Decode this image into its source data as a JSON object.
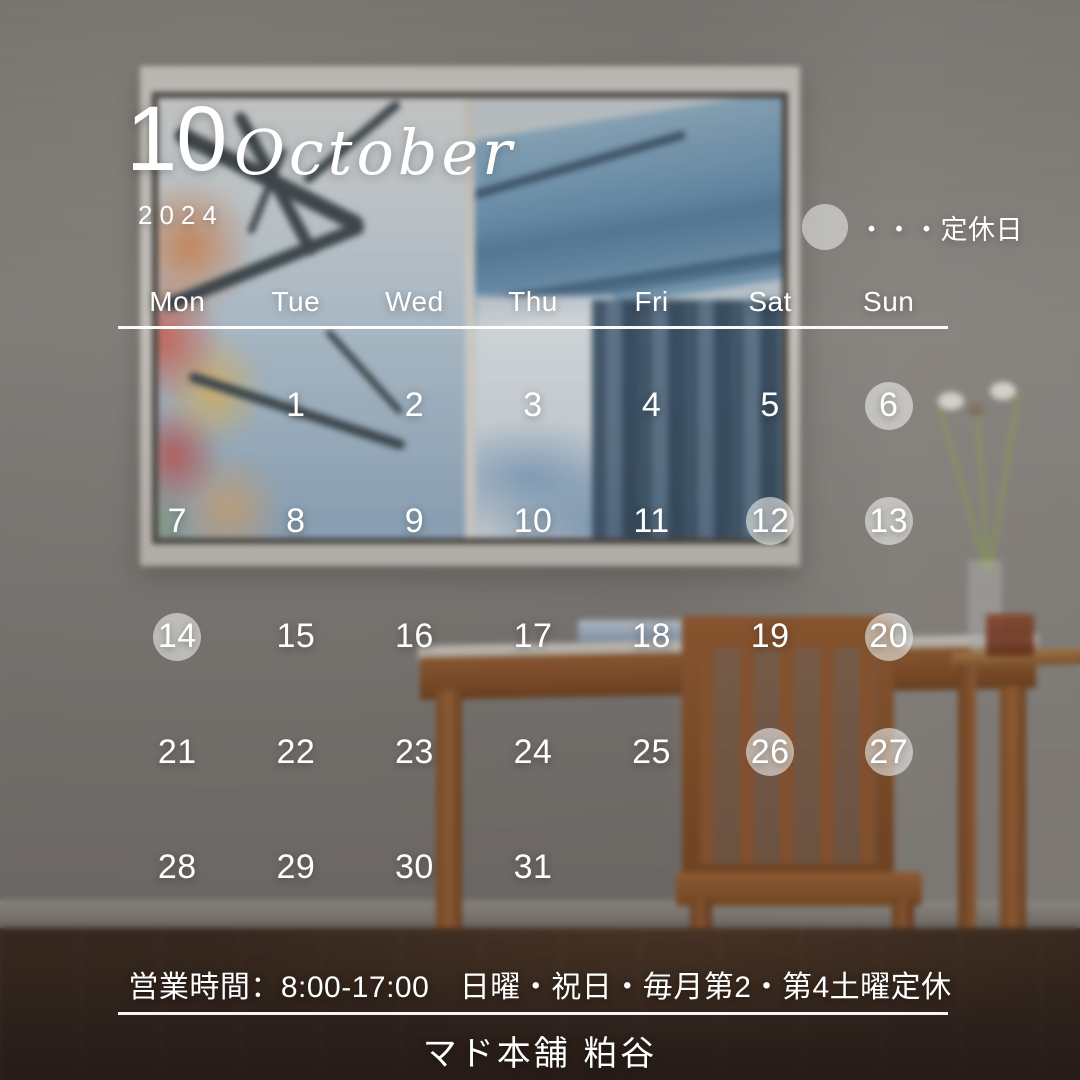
{
  "header": {
    "month_number": "10",
    "month_name": "October",
    "year": "2024"
  },
  "legend": {
    "icon": "closed-day-circle-icon",
    "text": "・・・定休日"
  },
  "weekdays": [
    "Mon",
    "Tue",
    "Wed",
    "Thu",
    "Fri",
    "Sat",
    "Sun"
  ],
  "calendar": {
    "weeks": [
      [
        {
          "day": "",
          "closed": false
        },
        {
          "day": "1",
          "closed": false
        },
        {
          "day": "2",
          "closed": false
        },
        {
          "day": "3",
          "closed": false
        },
        {
          "day": "4",
          "closed": false
        },
        {
          "day": "5",
          "closed": false
        },
        {
          "day": "6",
          "closed": true
        }
      ],
      [
        {
          "day": "7",
          "closed": false
        },
        {
          "day": "8",
          "closed": false
        },
        {
          "day": "9",
          "closed": false
        },
        {
          "day": "10",
          "closed": false
        },
        {
          "day": "11",
          "closed": false
        },
        {
          "day": "12",
          "closed": true
        },
        {
          "day": "13",
          "closed": true
        }
      ],
      [
        {
          "day": "14",
          "closed": true
        },
        {
          "day": "15",
          "closed": false
        },
        {
          "day": "16",
          "closed": false
        },
        {
          "day": "17",
          "closed": false
        },
        {
          "day": "18",
          "closed": false
        },
        {
          "day": "19",
          "closed": false
        },
        {
          "day": "20",
          "closed": true
        }
      ],
      [
        {
          "day": "21",
          "closed": false
        },
        {
          "day": "22",
          "closed": false
        },
        {
          "day": "23",
          "closed": false
        },
        {
          "day": "24",
          "closed": false
        },
        {
          "day": "25",
          "closed": false
        },
        {
          "day": "26",
          "closed": true
        },
        {
          "day": "27",
          "closed": true
        }
      ],
      [
        {
          "day": "28",
          "closed": false
        },
        {
          "day": "29",
          "closed": false
        },
        {
          "day": "30",
          "closed": false
        },
        {
          "day": "31",
          "closed": false
        },
        {
          "day": "",
          "closed": false
        },
        {
          "day": "",
          "closed": false
        },
        {
          "day": "",
          "closed": false
        }
      ]
    ]
  },
  "footer": {
    "hours": "営業時間：8:00-17:00　日曜・祝日・毎月第2・第4土曜定休",
    "shop_name": "マド本舗 粕谷"
  },
  "colors": {
    "text": "#ffffff",
    "closed_marker": "rgba(234,234,230,0.62)",
    "wall": "#8e8c89",
    "floor": "#352620",
    "wood": "#8a5129"
  }
}
